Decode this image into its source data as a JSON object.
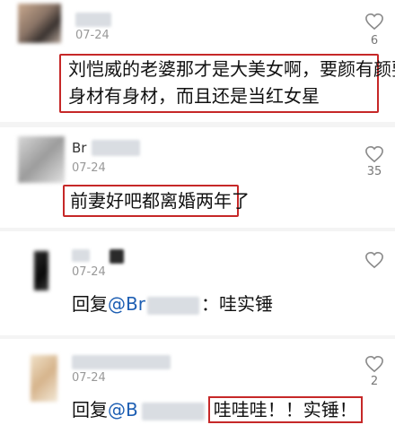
{
  "comments": [
    {
      "name": "",
      "date": "07-24",
      "likes": "6",
      "text_lines": [
        "刘恺威的老婆那才是大美女啊，要颜有颜要",
        "身材有身材，而且还是当红女星"
      ]
    },
    {
      "name": "Br",
      "date": "07-24",
      "likes": "35",
      "text_lines": [
        "前妻好吧都离婚两年了"
      ]
    },
    {
      "name": "",
      "date": "07-24",
      "likes": "",
      "reply_prefix": "回复",
      "mention": "@Br",
      "reply_text": "：哇实锤"
    },
    {
      "name": "",
      "date": "07-24",
      "likes": "2",
      "reply_prefix": "回复",
      "mention": "@B",
      "reply_text": "哇哇哇！！实锤！"
    }
  ],
  "colors": {
    "highlight": "#c62828",
    "mention": "#1e5fb3",
    "divider": "#f4f4f4"
  },
  "icons": {
    "like": "heart-outline-icon"
  }
}
